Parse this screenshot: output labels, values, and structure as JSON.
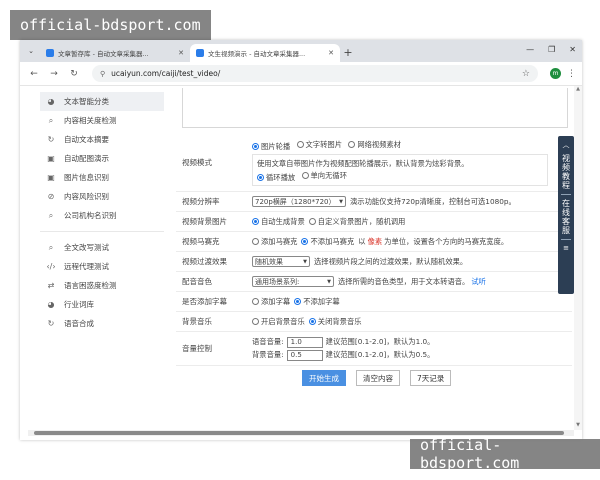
{
  "watermark": "official-bdsport.com",
  "browser": {
    "tabs": [
      {
        "title": "文章暂存库 - 自动文章采集器..."
      },
      {
        "title": "文生视频演示 - 自动文章采集器..."
      }
    ],
    "new_tab": "+",
    "url": "ucaiyun.com/caiji/test_video/"
  },
  "sidebar": {
    "items": [
      {
        "label": "文本智能分类",
        "icon": "pie-chart-icon"
      },
      {
        "label": "内容相关度检测",
        "icon": "search-icon"
      },
      {
        "label": "自动文本摘要",
        "icon": "refresh-icon"
      },
      {
        "label": "自动配图演示",
        "icon": "image-icon"
      },
      {
        "label": "图片信息识别",
        "icon": "image-icon"
      },
      {
        "label": "内容风险识别",
        "icon": "shield-icon"
      },
      {
        "label": "公司机构名识别",
        "icon": "search-icon"
      },
      {
        "label": "全文改写测试",
        "icon": "search-icon"
      },
      {
        "label": "远程代理测试",
        "icon": "code-icon"
      },
      {
        "label": "语言困惑度检测",
        "icon": "shuffle-icon"
      },
      {
        "label": "行业词库",
        "icon": "pie-chart-icon"
      },
      {
        "label": "语音合成",
        "icon": "refresh-icon"
      }
    ]
  },
  "form": {
    "mode": {
      "label": "视频模式",
      "options": [
        "图片轮播",
        "文字转图片",
        "网络视频素材"
      ],
      "selected": "图片轮播",
      "description": "使用文章自带图片作为视频配图轮播展示，默认背景为炫彩背景。",
      "loop_options": [
        "循环播放",
        "单向无循环"
      ],
      "loop_selected": "循环播放"
    },
    "resolution": {
      "label": "视频分辨率",
      "value": "720p横屏（1280*720）",
      "note": "演示功能仅支持720p清晰度，控制台可选1080p。"
    },
    "bg_image": {
      "label": "视频背景图片",
      "options": [
        "自动生成背景",
        "自定义背景图片，随机调用"
      ],
      "selected": "自动生成背景"
    },
    "border": {
      "label": "视频马赛克",
      "options": [
        "添加马赛克",
        "不添加马赛克"
      ],
      "selected": "不添加马赛克",
      "note_prefix": "以",
      "note_highlight": "像素",
      "note_suffix": "为单位，设置各个方向的马赛克宽度。"
    },
    "transition": {
      "label": "视频过渡效果",
      "value": "随机效果",
      "note": "选择视频片段之间的过渡效果，默认随机效果。"
    },
    "voice": {
      "label": "配音音色",
      "value": "通用场景系列:",
      "note": "选择所需的音色类型，用于文本转语音。",
      "link": "试听"
    },
    "subtitle": {
      "label": "是否添加字幕",
      "options": [
        "添加字幕",
        "不添加字幕"
      ],
      "selected": "不添加字幕"
    },
    "bgm": {
      "label": "背景音乐",
      "options": [
        "开启背景音乐",
        "关闭背景音乐"
      ],
      "selected": "关闭背景音乐"
    },
    "volume": {
      "label": "音量控制",
      "voice_label": "语音音量:",
      "voice_value": "1.0",
      "voice_note": "建议范围[0.1-2.0]，默认为1.0。",
      "bg_label": "背景音量:",
      "bg_value": "0.5",
      "bg_note": "建议范围[0.1-2.0]，默认为0.5。"
    }
  },
  "actions": {
    "generate": "开始生成",
    "clear": "清空内容",
    "history": "7天记录"
  },
  "float_widget": {
    "top_label": "视频教程",
    "bottom_label": "在线客服"
  }
}
